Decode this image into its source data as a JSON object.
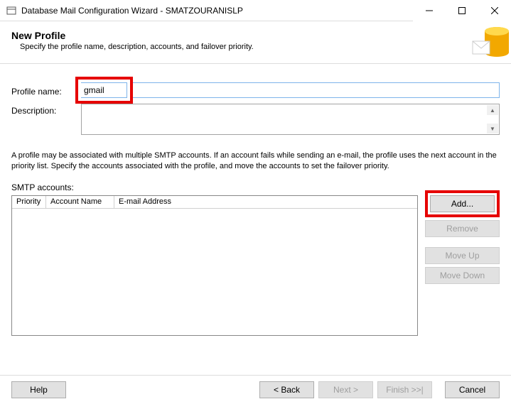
{
  "window": {
    "title": "Database Mail Configuration Wizard - SMATZOURANISLP"
  },
  "header": {
    "title": "New Profile",
    "subtitle": "Specify the profile name, description, accounts, and failover priority."
  },
  "form": {
    "profile_name_label": "Profile name:",
    "profile_name_value": "gmail",
    "description_label": "Description:",
    "description_value": ""
  },
  "info_text": "A profile may be associated with multiple SMTP accounts. If an account fails while sending an e-mail, the profile uses the next account in the priority list. Specify the accounts associated with the profile, and move the accounts to set the failover priority.",
  "smtp": {
    "label": "SMTP accounts:",
    "columns": {
      "priority": "Priority",
      "account": "Account Name",
      "email": "E-mail Address"
    },
    "rows": []
  },
  "side_buttons": {
    "add": "Add...",
    "remove": "Remove",
    "move_up": "Move Up",
    "move_down": "Move Down"
  },
  "footer": {
    "help": "Help",
    "back": "< Back",
    "next": "Next >",
    "finish": "Finish >>|",
    "cancel": "Cancel"
  }
}
